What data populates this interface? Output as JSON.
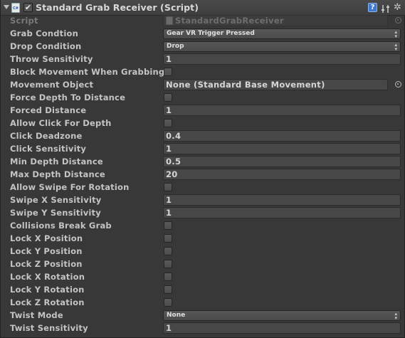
{
  "header": {
    "title": "Standard Grab Receiver (Script)",
    "script_icon_text": "C#",
    "enabled_check": "✔",
    "help_icon": "?",
    "gear_icon": "✲"
  },
  "fields": {
    "script": {
      "label": "Script",
      "value": "StandardGrabReceiver"
    },
    "grab_condition": {
      "label": "Grab Condtion",
      "value": "Gear VR Trigger Pressed"
    },
    "drop_condition": {
      "label": "Drop Condition",
      "value": "Drop"
    },
    "throw_sensitivity": {
      "label": "Throw Sensitivity",
      "value": "1"
    },
    "block_movement": {
      "label": "Block Movement When Grabbing",
      "checked": false
    },
    "movement_object": {
      "label": "Movement Object",
      "value": "None (Standard Base Movement)"
    },
    "force_depth": {
      "label": "Force Depth To Distance",
      "checked": false
    },
    "forced_distance": {
      "label": "Forced Distance",
      "value": "1"
    },
    "allow_click_depth": {
      "label": "Allow Click For Depth",
      "checked": false
    },
    "click_deadzone": {
      "label": "Click Deadzone",
      "value": "0.4"
    },
    "click_sensitivity": {
      "label": "Click Sensitivity",
      "value": "1"
    },
    "min_depth": {
      "label": "Min Depth Distance",
      "value": "0.5"
    },
    "max_depth": {
      "label": "Max Depth Distance",
      "value": "20"
    },
    "allow_swipe": {
      "label": "Allow Swipe For Rotation",
      "checked": false
    },
    "swipe_x": {
      "label": "Swipe X Sensitivity",
      "value": "1"
    },
    "swipe_y": {
      "label": "Swipe Y Sensitivity",
      "value": "1"
    },
    "collisions_break": {
      "label": "Collisions Break Grab",
      "checked": false
    },
    "lock_x_pos": {
      "label": "Lock X Position",
      "checked": false
    },
    "lock_y_pos": {
      "label": "Lock Y Position",
      "checked": false
    },
    "lock_z_pos": {
      "label": "Lock Z Position",
      "checked": false
    },
    "lock_x_rot": {
      "label": "Lock X Rotation",
      "checked": false
    },
    "lock_y_rot": {
      "label": "Lock Y Rotation",
      "checked": false
    },
    "lock_z_rot": {
      "label": "Lock Z Rotation",
      "checked": false
    },
    "twist_mode": {
      "label": "Twist Mode",
      "value": "None"
    },
    "twist_sensitivity": {
      "label": "Twist Sensitivity",
      "value": "1"
    }
  },
  "dropdown_arrow": "▲\n▼",
  "colors": {
    "panel_background": "#383838",
    "field_background": "#474747",
    "label_text": "#c4c4c4",
    "help_icon_blue": "#3e7bd0"
  }
}
